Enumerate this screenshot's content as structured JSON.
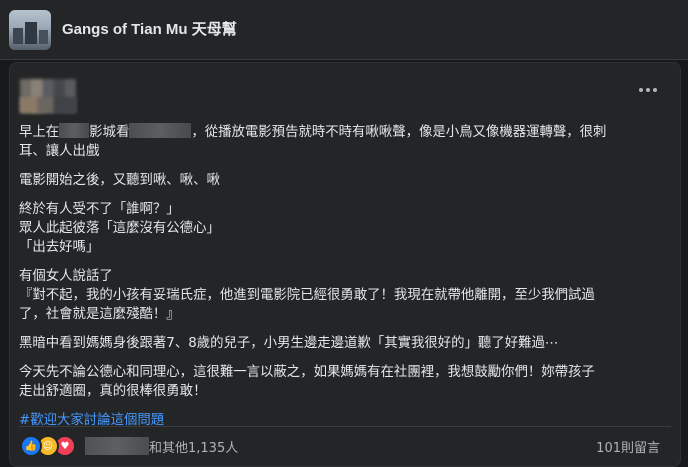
{
  "group": {
    "name": "Gangs of Tian Mu 天母幫"
  },
  "post": {
    "lines": {
      "l1_a": "早上在",
      "l1_b": "影城看",
      "l1_c": "，從播放電影預告就時不時有啾啾聲，像是小鳥又像機器運轉聲，很刺",
      "l1_d": "耳、讓人出戲",
      "l2": "電影開始之後，又聽到啾、啾、啾",
      "l3_a": "終於有人受不了「誰啊？」",
      "l3_b": "眾人此起彼落「這麼沒有公德心」",
      "l3_c": "「出去好嗎」",
      "l4_a": "有個女人說話了",
      "l4_b": "『對不起，我的小孩有妥瑞氏症，他進到電影院已經很勇敢了！我現在就帶他離開，至少我們試過",
      "l4_c": "了，社會就是這麼殘酷！』",
      "l5": "黑暗中看到媽媽身後跟著7、8歲的兒子，小男生邊走邊道歉「其實我很好的」聽了好難過⋯",
      "l6_a": "今天先不論公德心和同理心，這很難一言以蔽之，如果媽媽有在社團裡，我想鼓勵你們！妳帶孩子",
      "l6_b": "走出舒適圈，真的很棒很勇敢！",
      "hashtag": "#歡迎大家討論這個問題"
    }
  },
  "footer": {
    "reaction_suffix": "和其他1,135人",
    "comments": "101則留言"
  }
}
